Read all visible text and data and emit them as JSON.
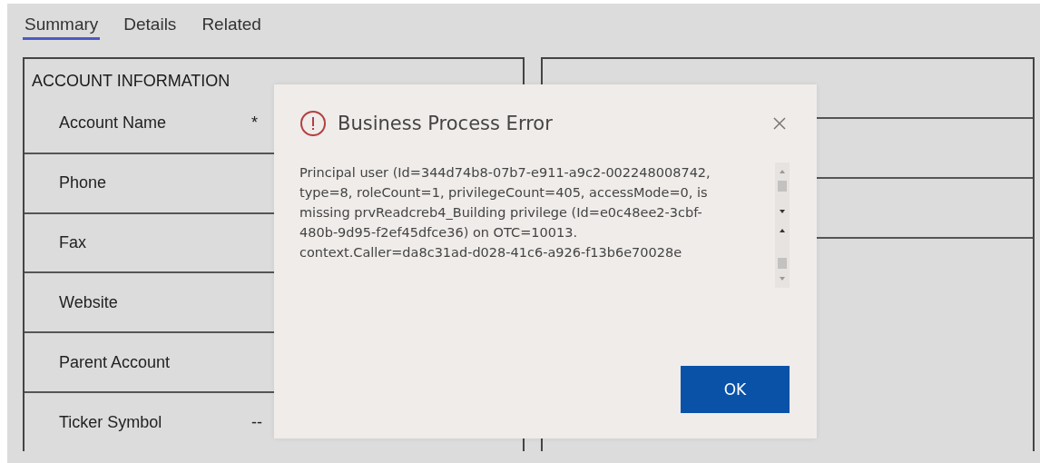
{
  "tabs": [
    {
      "label": "Summary",
      "selected": true
    },
    {
      "label": "Details",
      "selected": false
    },
    {
      "label": "Related",
      "selected": false
    }
  ],
  "account_section": {
    "title": "ACCOUNT INFORMATION",
    "fields": [
      {
        "label": "Account Name",
        "value": "*"
      },
      {
        "label": "Phone"
      },
      {
        "label": "Fax"
      },
      {
        "label": "Website"
      },
      {
        "label": "Parent Account"
      },
      {
        "label": "Ticker Symbol",
        "value": "--"
      }
    ]
  },
  "dialog": {
    "title": "Business Process Error",
    "message": "Principal user (Id=344d74b8-07b7-e911-a9c2-002248008742, type=8, roleCount=1, privilegeCount=405, accessMode=0, is missing prvReadcreb4_Building privilege (Id=e0c48ee2-3cbf-480b-9d95-f2ef45dfce36) on OTC=10013. context.Caller=da8c31ad-d028-41c6-a926-f13b6e70028e",
    "buttons": [
      "OK"
    ]
  }
}
